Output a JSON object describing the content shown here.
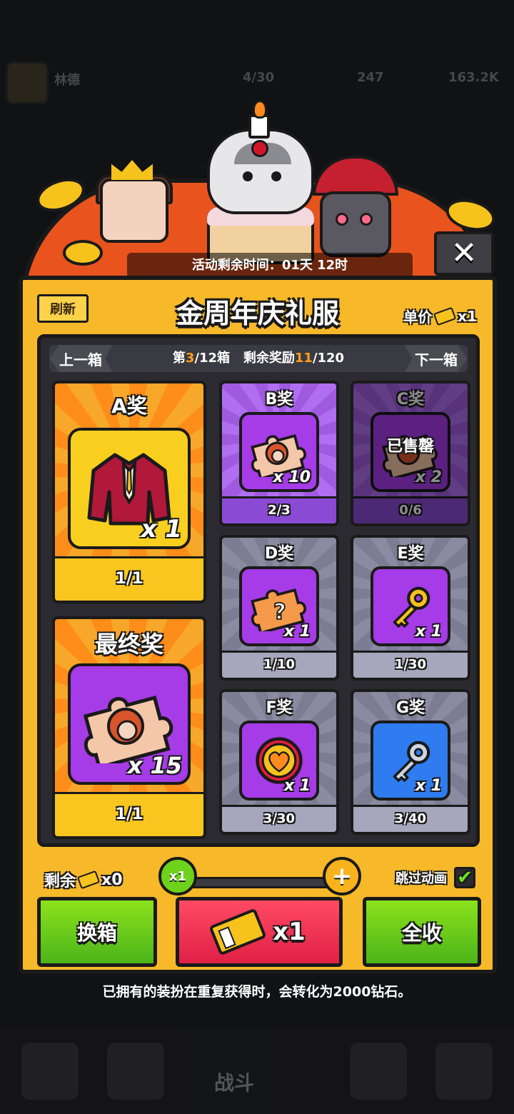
{
  "background": {
    "player_name": "林德",
    "stat_1": "4/30",
    "stat_2": "247",
    "stat_3": "163.2K",
    "battle_label": "战斗"
  },
  "event": {
    "timer_label": "活动剩余时间：",
    "timer_value": "01天 12时"
  },
  "panel": {
    "refresh_label": "刷新",
    "title": "金周年庆礼服",
    "unit_price_label": "单价",
    "unit_price_value": "x1"
  },
  "nav": {
    "prev_label": "上一箱",
    "next_label": "下一箱",
    "box_prefix": "第",
    "box_current": "3",
    "box_total": "/12箱",
    "remain_label": "剩余奖励",
    "remain_current": "11",
    "remain_total": "/120"
  },
  "prizes": {
    "a": {
      "title": "A奖",
      "count": "x 1",
      "progress": "1/1",
      "icon": "robe-icon"
    },
    "final": {
      "title": "最终奖",
      "count": "x 15",
      "progress": "1/1",
      "icon": "puzzle-portrait-icon"
    },
    "b": {
      "title": "B奖",
      "count": "x 10",
      "progress": "2/3",
      "icon": "puzzle-portrait-icon"
    },
    "c": {
      "title": "C奖",
      "count": "x 2",
      "progress": "0/6",
      "sold_out": "已售罄",
      "icon": "puzzle-portrait-icon"
    },
    "d": {
      "title": "D奖",
      "count": "x 1",
      "progress": "1/10",
      "icon": "puzzle-question-icon"
    },
    "e": {
      "title": "E奖",
      "count": "x 1",
      "progress": "1/30",
      "icon": "gold-key-icon"
    },
    "f": {
      "title": "F奖",
      "count": "x 1",
      "progress": "3/30",
      "icon": "heart-medal-icon"
    },
    "g": {
      "title": "G奖",
      "count": "x 1",
      "progress": "3/40",
      "icon": "silver-key-icon"
    }
  },
  "controls": {
    "remain_label": "剩余",
    "remain_value": "x0",
    "qty_min": "x1",
    "qty_plus": "+",
    "skip_label": "跳过动画",
    "skip_checked": true,
    "change_box_label": "换箱",
    "draw_label": "x1",
    "collect_all_label": "全收"
  },
  "note": "已拥有的装扮在重复获得时，会转化为2000钻石。",
  "colors": {
    "panel_yellow": "#f7b92a",
    "accent_orange": "#ff9f1c",
    "green_button": "#6dd21c",
    "red_button": "#e02046",
    "purple_card": "#a05ae0"
  }
}
